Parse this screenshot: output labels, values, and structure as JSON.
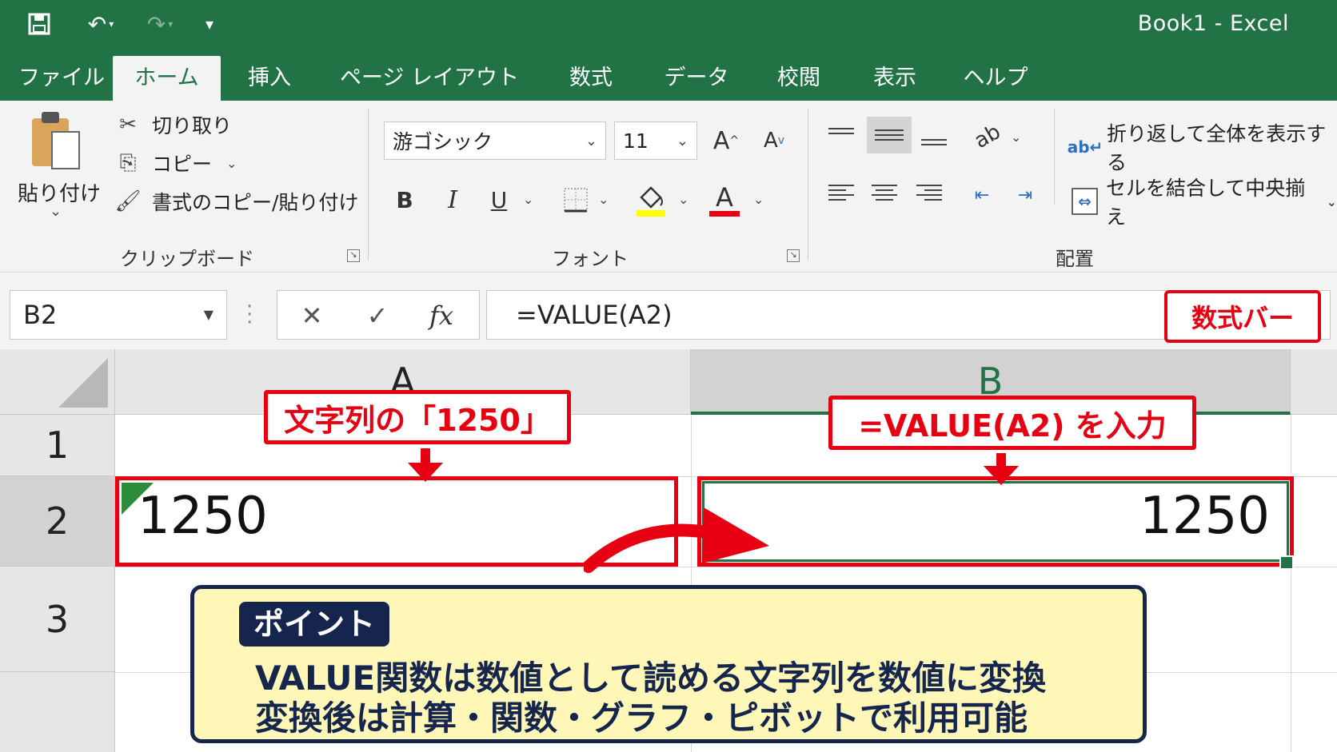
{
  "window": {
    "title": "Book1  -  Excel"
  },
  "quick_access": {
    "save": "🖫",
    "undo": "↶",
    "redo": "↷",
    "customize": "▾"
  },
  "tabs": [
    {
      "label": "ファイル"
    },
    {
      "label": "ホーム"
    },
    {
      "label": "挿入"
    },
    {
      "label": "ページ レイアウト"
    },
    {
      "label": "数式"
    },
    {
      "label": "データ"
    },
    {
      "label": "校閲"
    },
    {
      "label": "表示"
    },
    {
      "label": "ヘルプ"
    }
  ],
  "clipboard": {
    "paste_label": "貼り付け",
    "cut_label": "切り取り",
    "copy_label": "コピー",
    "format_painter_label": "書式のコピー/貼り付け",
    "group_label": "クリップボード"
  },
  "font": {
    "font_name": "游ゴシック",
    "font_size": "11",
    "grow_label": "A",
    "shrink_label": "A",
    "bold": "B",
    "italic": "I",
    "underline": "U",
    "font_color_glyph": "A",
    "group_label": "フォント",
    "highlight_color": "#ffff00",
    "font_color": "#e60012"
  },
  "alignment": {
    "wrap_text_label": "折り返して全体を表示する",
    "merge_center_label": "セルを結合して中央揃え",
    "group_label": "配置"
  },
  "formula_bar": {
    "name_box": "B2",
    "cancel": "✕",
    "enter": "✓",
    "fx": "fx",
    "formula": "=VALUE(A2)",
    "callout": "数式バー"
  },
  "sheet": {
    "columns": [
      "A",
      "B"
    ],
    "rows": [
      "1",
      "2",
      "3"
    ],
    "cells": {
      "A2": "1250",
      "B2": "1250"
    }
  },
  "annotations": {
    "a_label": "文字列の「1250」",
    "b_label": "=VALUE(A2) を入力"
  },
  "point": {
    "tag": "ポイント",
    "line1": "VALUE関数は数値として読める文字列を数値に変換",
    "line2": "変換後は計算・関数・グラフ・ピボットで利用可能"
  },
  "colors": {
    "excel_green": "#217346",
    "accent_red": "#e60012",
    "point_navy": "#15254d",
    "point_fill": "#fef7b7"
  }
}
